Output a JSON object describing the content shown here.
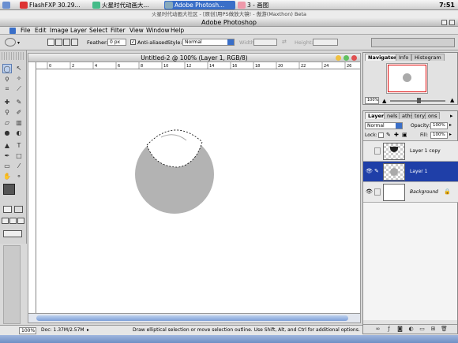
{
  "taskbar": {
    "tasks": [
      "FlashFXP  30.29...",
      "火星时代动画大...",
      "Adobe Photosh...",
      "3 - 画图"
    ],
    "clock": "7:51"
  },
  "subtitle": "火星时代动画大社区 - [原创]用PS做放大镜! - 傲游(Maxthon) Beta",
  "app_title": "Adobe Photoshop",
  "menu": [
    "File",
    "Edit",
    "Image",
    "Layer",
    "Select",
    "Filter",
    "View",
    "Window",
    "Help"
  ],
  "options": {
    "feather_label": "Feather:",
    "feather_value": "0 px",
    "antialias_label": "Anti-aliased",
    "antialias_checked": true,
    "style_label": "Style:",
    "style_value": "Normal",
    "width_label": "Width:",
    "height_label": "Height:"
  },
  "document": {
    "title": "Untitled-2 @ 100% (Layer 1, RGB/8)",
    "ruler_ticks": [
      "0",
      "2",
      "4",
      "6",
      "8",
      "10",
      "12",
      "14",
      "16",
      "18",
      "20",
      "22",
      "24",
      "26"
    ]
  },
  "status": {
    "zoom": "100%",
    "doc": "Doc: 1.37M/2.57M",
    "hint": "Draw elliptical selection or move selection outline.  Use Shift, Alt, and Ctrl for additional options."
  },
  "navigator": {
    "tabs": [
      "Navigator",
      "Info",
      "Histogram"
    ],
    "zoom": "100%"
  },
  "layers": {
    "tabs": [
      "Layers",
      "nels",
      "aths",
      "tory",
      "ons"
    ],
    "blend_mode": "Normal",
    "opacity_label": "Opacity:",
    "opacity_value": "100%",
    "lock_label": "Lock:",
    "fill_label": "Fill:",
    "fill_value": "100%",
    "items": [
      {
        "name": "Layer 1 copy",
        "visible": false,
        "selected": false
      },
      {
        "name": "Layer 1",
        "visible": true,
        "selected": true
      },
      {
        "name": "Background",
        "visible": true,
        "selected": false,
        "locked": true
      }
    ]
  },
  "colors": {
    "accent": "#3a6fc8",
    "selection": "#1f3fa8",
    "circle": "#b3b3b3"
  }
}
